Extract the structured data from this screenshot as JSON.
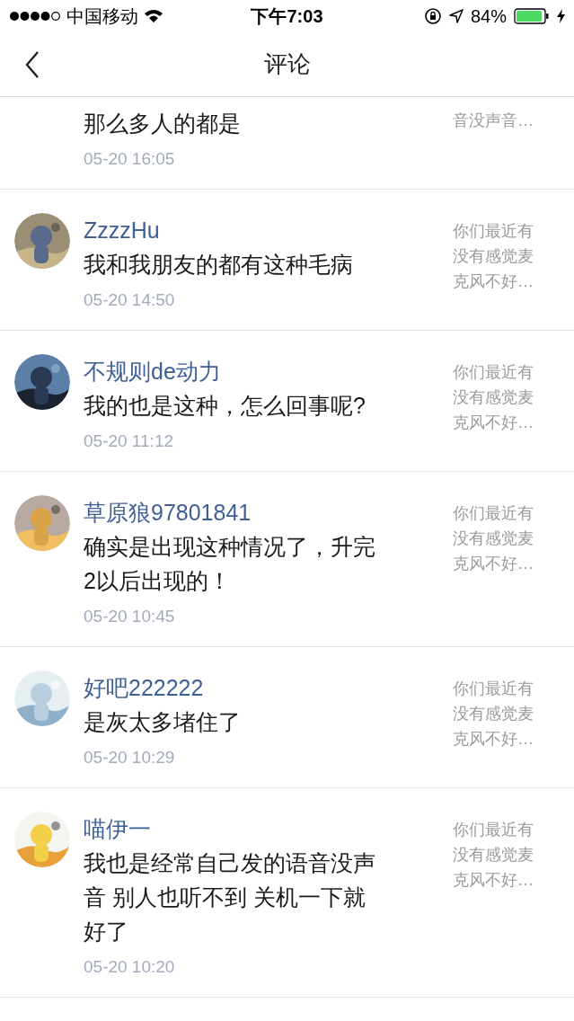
{
  "status_bar": {
    "carrier": "中国移动",
    "time": "下午7:03",
    "battery": "84%"
  },
  "header": {
    "title": "评论"
  },
  "comments": [
    {
      "kind": "partial",
      "text": "那么多人的都是",
      "time": "05-20 16:05",
      "quote": "音没声音…"
    },
    {
      "kind": "full",
      "name": "ZzzzHu",
      "text": "我和我朋友的都有这种毛病",
      "time": "05-20 14:50",
      "quote": "你们最近有没有感觉麦克风不好…"
    },
    {
      "kind": "full",
      "name": "不规则de动力",
      "text": "我的也是这种，怎么回事呢?",
      "time": "05-20 11:12",
      "quote": "你们最近有没有感觉麦克风不好…"
    },
    {
      "kind": "full",
      "name": "草原狼97801841",
      "text": "确实是出现这种情况了，升完2以后出现的！",
      "time": "05-20 10:45",
      "quote": "你们最近有没有感觉麦克风不好…"
    },
    {
      "kind": "full",
      "name": "好吧222222",
      "text": "是灰太多堵住了",
      "time": "05-20 10:29",
      "quote": "你们最近有没有感觉麦克风不好…"
    },
    {
      "kind": "full",
      "name": "喵伊一",
      "text": "我也是经常自己发的语音没声音 别人也听不到 关机一下就好了",
      "time": "05-20 10:20",
      "quote": "你们最近有没有感觉麦克风不好…"
    }
  ]
}
